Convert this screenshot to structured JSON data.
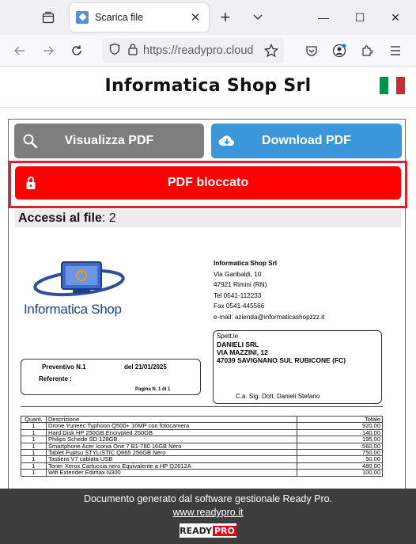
{
  "browser": {
    "tab_title": "Scarica file",
    "url": "https://readypro.cloud",
    "tab_close_glyph": "✕",
    "new_tab_glyph": "+",
    "window_controls": {
      "minimize": "—",
      "maximize": "☐",
      "close": "✕"
    }
  },
  "site": {
    "title": "Informatica Shop Srl",
    "flag_colors": [
      "#009246",
      "#ffffff",
      "#ce2b37"
    ]
  },
  "buttons": {
    "view_pdf": "Visualizza PDF",
    "download_pdf": "Download PDF",
    "pdf_locked": "PDF bloccato"
  },
  "access": {
    "label": "Accessi al file",
    "separator": ": ",
    "count": "2"
  },
  "pdf": {
    "logo_text": "Informatica Shop",
    "company": {
      "name": "Informatica Shop Srl",
      "address": "Via Garibaldi, 10",
      "city": "47921 Rimini (RN)",
      "tel": "Tel 0541-112233",
      "fax": "Fax 0541-445566",
      "email": "e-mail: azienda@informaticashopzzz.it"
    },
    "recipient": {
      "label": "Spett.le",
      "name": "DANIELI SRL",
      "street": "VIA MAZZINI, 12",
      "city": "47039 SAVIGNANO SUL RUBICONE (FC)",
      "attn": "C.a. Sig. Dott. Danieli Stefano"
    },
    "document": {
      "type_no": "Preventivo N.1",
      "date": "del  21/01/2025",
      "reference": "Referente :",
      "page_no": "Pagina N.  1     di  1"
    },
    "table": {
      "headers": [
        "Quant.",
        "Descrizione",
        "Totale"
      ],
      "rows": [
        [
          "1",
          "Drone Yuneec Typhoon Q500+ 16MP con fotocamera",
          "920,00"
        ],
        [
          "1",
          "Hard Disk HP 250GB Encrypted 250GB",
          "140,00"
        ],
        [
          "1",
          "Philips Schede SD 128GB",
          "195,00"
        ],
        [
          "1",
          "Smartphone Acer Iconia One 7 B1-780 16GB Nero",
          "560,00"
        ],
        [
          "1",
          "Tablet Fujitsu STYLISTIC Q665 256GB Nero",
          "750,00"
        ],
        [
          "1",
          "Tastiera V7 cablata USB",
          "50,00"
        ],
        [
          "1",
          "Toner Xerox Cartuccia nero Equivalente a HP Q2612A",
          "480,00"
        ],
        [
          "1",
          "Wifi Extender Edimax N300",
          "100,00"
        ]
      ]
    }
  },
  "footer": {
    "text": "Documento generato dal software gestionale Ready Pro.",
    "link": "www.readypro.it",
    "logo_ready": "READY",
    "logo_pro": "PRO"
  },
  "colors": {
    "view_button": "#7e7e7e",
    "download_button": "#3b97d9",
    "locked_button": "#ff0000",
    "locked_frame": "#e0202a",
    "footer_bg": "#3d3d3d"
  }
}
